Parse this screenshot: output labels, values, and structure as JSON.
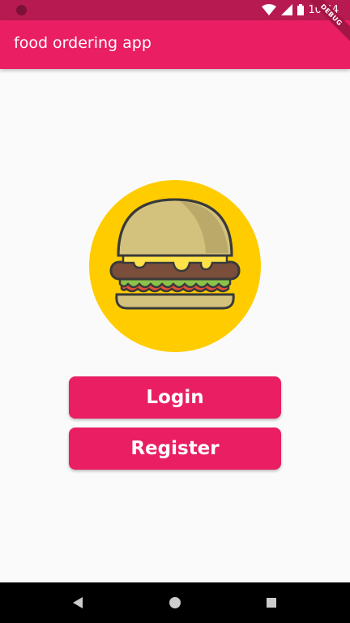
{
  "status_bar": {
    "time": "10:44",
    "icons": [
      "camera-icon",
      "wifi-icon",
      "signal-icon",
      "battery-icon"
    ]
  },
  "debug_banner": "DEBUG",
  "app_bar": {
    "title": "food ordering app",
    "color": "#e91e63"
  },
  "logo": {
    "icon": "burger-icon",
    "background": "#ffcc00"
  },
  "buttons": {
    "login": "Login",
    "register": "Register"
  },
  "nav_bar": {
    "icons": [
      "back-icon",
      "home-icon",
      "recents-icon"
    ]
  }
}
